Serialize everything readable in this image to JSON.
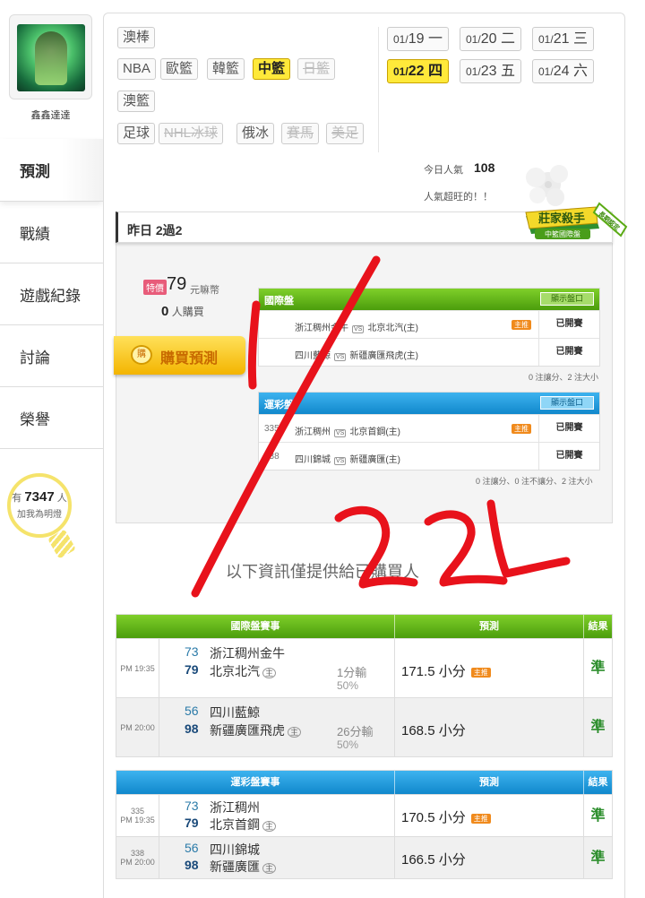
{
  "user": {
    "name": "鑫鑫達達"
  },
  "sidebar": {
    "items": [
      {
        "label": "預測"
      },
      {
        "label": "戰績"
      },
      {
        "label": "遊戲紀錄"
      },
      {
        "label": "討論"
      },
      {
        "label": "榮譽"
      }
    ],
    "fans": {
      "prefix": "有",
      "count": "7347",
      "suffix": "人",
      "note": "加我為明燈"
    }
  },
  "sports": {
    "row1": [
      "澳棒"
    ],
    "row2": [
      "NBA",
      "歐籃",
      "韓籃",
      "中籃",
      "日籃"
    ],
    "row3": [
      "澳籃"
    ],
    "row4": [
      "足球",
      "NHL冰球",
      "俄冰",
      "賽馬",
      "美足"
    ],
    "selected": "中籃",
    "disabled": [
      "日籃",
      "NHL冰球",
      "賽馬",
      "美足"
    ]
  },
  "dates": [
    {
      "md": "01/",
      "d": "19",
      "wd": "一"
    },
    {
      "md": "01/",
      "d": "20",
      "wd": "二"
    },
    {
      "md": "01/",
      "d": "21",
      "wd": "三"
    },
    {
      "md": "01/",
      "d": "22",
      "wd": "四"
    },
    {
      "md": "01/",
      "d": "23",
      "wd": "五"
    },
    {
      "md": "01/",
      "d": "24",
      "wd": "六"
    }
  ],
  "popularity": {
    "label": "今日人氣",
    "value": "108",
    "note": "人氣超旺的！！"
  },
  "record": {
    "yesterday": "昨日 2過2"
  },
  "badge": {
    "title": "莊家殺手",
    "sub": "中籃國際盤",
    "ribbon": "長期認定"
  },
  "purchase": {
    "tag": "特價",
    "price": "79",
    "unit": "元嘛幣",
    "buyers_count": "0",
    "buyers_label": "人購買",
    "button": "購買預測",
    "icon_text": "購"
  },
  "intl_panel": {
    "title": "國際盤",
    "show_label": "顯示盤口",
    "rows": [
      {
        "num": "",
        "away": "浙江稠州金牛",
        "home": "北京北汽(主)",
        "status": "已開賽",
        "pill": "主推"
      },
      {
        "num": "",
        "away": "四川藍鯨",
        "home": "新疆廣匯飛虎(主)",
        "status": "已開賽",
        "pill": ""
      }
    ],
    "footer": "0 注讓分、2 注大小"
  },
  "lottery_panel": {
    "title": "運彩盤",
    "show_label": "顯示盤口",
    "rows": [
      {
        "num": "335",
        "away": "浙江稠州",
        "home": "北京首鋼(主)",
        "status": "已開賽",
        "pill": "主推"
      },
      {
        "num": "338",
        "away": "四川錦城",
        "home": "新疆廣匯(主)",
        "status": "已開賽",
        "pill": ""
      }
    ],
    "footer": "0 注讓分、0 注不讓分、2 注大小"
  },
  "info_text": "以下資訊僅提供給已購買人",
  "intl_table": {
    "headers": [
      "國際盤賽事",
      "預測",
      "結果"
    ],
    "rows": [
      {
        "time": "PM 19:35",
        "num": "",
        "s1": "73",
        "t1": "浙江稠州金牛",
        "s2": "79",
        "t2": "北京北汽",
        "handicap": "1分輸",
        "pct": "50%",
        "pred": "171.5 小分",
        "pill": "主推",
        "result": "準"
      },
      {
        "time": "PM 20:00",
        "num": "",
        "s1": "56",
        "t1": "四川藍鯨",
        "s2": "98",
        "t2": "新疆廣匯飛虎",
        "handicap": "26分輸",
        "pct": "50%",
        "pred": "168.5 小分",
        "pill": "",
        "result": "準"
      }
    ]
  },
  "lottery_table": {
    "headers": [
      "運彩盤賽事",
      "預測",
      "結果"
    ],
    "rows": [
      {
        "time": "PM 19:35",
        "num": "335",
        "s1": "73",
        "t1": "浙江稠州",
        "s2": "79",
        "t2": "北京首鋼",
        "pred": "170.5 小分",
        "pill": "主推",
        "result": "準"
      },
      {
        "time": "PM 20:00",
        "num": "338",
        "s1": "56",
        "t1": "四川錦城",
        "s2": "98",
        "t2": "新疆廣匯",
        "pred": "166.5 小分",
        "pill": "",
        "result": "準"
      }
    ]
  },
  "home_mark": "主",
  "annotation": {
    "text": "1/22 L",
    "color": "#e8121b"
  },
  "colors": {
    "accent_yellow": "#ffe93a",
    "green_header": "#5aaa14",
    "blue_header": "#1a9ad9",
    "result_green": "#2a8d2a",
    "annotation_red": "#e8121b"
  }
}
